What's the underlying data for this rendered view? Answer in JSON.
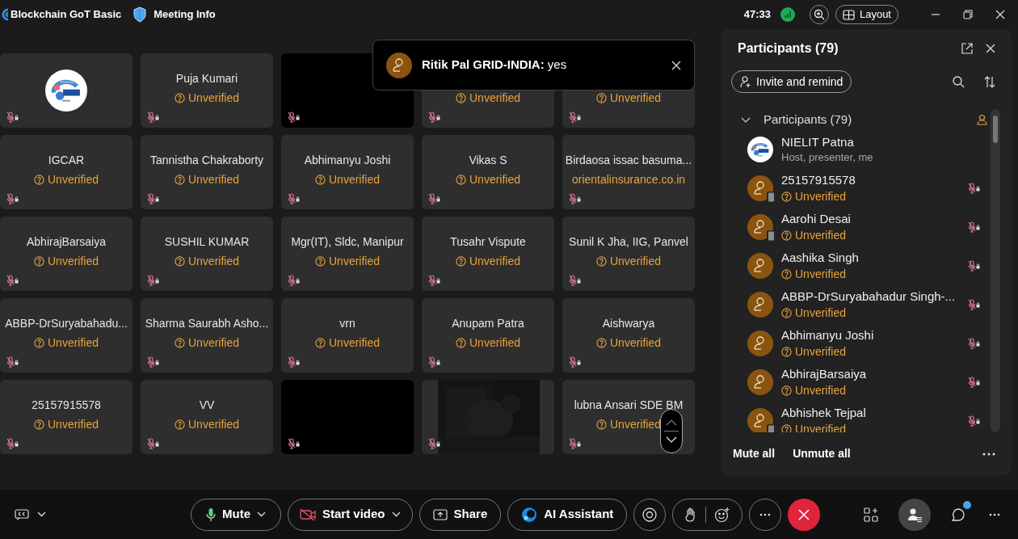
{
  "title_bar": {
    "meeting_name": "Blockchain GoT Basic",
    "meeting_info": "Meeting Info",
    "timer": "47:33",
    "layout_button": "Layout"
  },
  "toast": {
    "sender": "Ritik Pal GRID-INDIA:",
    "message": "yes"
  },
  "tiles": [
    {
      "kind": "logo"
    },
    {
      "kind": "person",
      "name": "Puja Kumari",
      "status": {
        "kind": "unverified",
        "text": "Unverified"
      }
    },
    {
      "kind": "video"
    },
    {
      "kind": "person",
      "status": {
        "kind": "unverified",
        "text": "Unverified"
      }
    },
    {
      "kind": "person",
      "status": {
        "kind": "unverified",
        "text": "Unverified"
      }
    },
    {
      "kind": "person",
      "name": "IGCAR",
      "status": {
        "kind": "unverified",
        "text": "Unverified"
      }
    },
    {
      "kind": "person",
      "name": "Tannistha Chakraborty",
      "status": {
        "kind": "unverified",
        "text": "Unverified"
      }
    },
    {
      "kind": "person",
      "name": "Abhimanyu Joshi",
      "status": {
        "kind": "unverified",
        "text": "Unverified"
      }
    },
    {
      "kind": "person",
      "name": "Vikas S",
      "status": {
        "kind": "unverified",
        "text": "Unverified"
      }
    },
    {
      "kind": "person",
      "name": "Birdaosa issac basuma...",
      "status": {
        "kind": "domain",
        "text": "orientalinsurance.co.in"
      }
    },
    {
      "kind": "person",
      "name": "AbhirajBarsaiya",
      "status": {
        "kind": "unverified",
        "text": "Unverified"
      }
    },
    {
      "kind": "person",
      "name": "SUSHIL KUMAR",
      "status": {
        "kind": "unverified",
        "text": "Unverified"
      }
    },
    {
      "kind": "person",
      "name": "Mgr(IT), Sldc, Manipur",
      "status": {
        "kind": "unverified",
        "text": "Unverified"
      }
    },
    {
      "kind": "person",
      "name": "Tusahr Vispute",
      "status": {
        "kind": "unverified",
        "text": "Unverified"
      }
    },
    {
      "kind": "person",
      "name": "Sunil K Jha, IIG, Panvel",
      "status": {
        "kind": "unverified",
        "text": "Unverified"
      }
    },
    {
      "kind": "person",
      "name": "ABBP-DrSuryabahadu...",
      "status": {
        "kind": "unverified",
        "text": "Unverified"
      }
    },
    {
      "kind": "person",
      "name": "Sharma Saurabh Asho...",
      "status": {
        "kind": "unverified",
        "text": "Unverified"
      }
    },
    {
      "kind": "person",
      "name": "vrn",
      "status": {
        "kind": "unverified",
        "text": "Unverified"
      }
    },
    {
      "kind": "person",
      "name": "Anupam Patra",
      "status": {
        "kind": "unverified",
        "text": "Unverified"
      }
    },
    {
      "kind": "person",
      "name": "Aishwarya",
      "status": {
        "kind": "unverified",
        "text": "Unverified"
      }
    },
    {
      "kind": "person",
      "name": "25157915578",
      "status": {
        "kind": "unverified",
        "text": "Unverified"
      }
    },
    {
      "kind": "person",
      "name": "VV",
      "status": {
        "kind": "unverified",
        "text": "Unverified"
      }
    },
    {
      "kind": "video"
    },
    {
      "kind": "picture"
    },
    {
      "kind": "person",
      "name": "lubna Ansari SDE BM",
      "status": {
        "kind": "unverified",
        "text": "Unverified"
      }
    }
  ],
  "panel": {
    "title": "Participants (79)",
    "invite_button": "Invite and remind",
    "group": {
      "label": "Participants (79)",
      "expanded": true
    },
    "participants": [
      {
        "kind": "logo",
        "name": "NIELIT Patna",
        "subtitle": {
          "kind": "role",
          "text": "Host, presenter, me"
        },
        "mobile": false
      },
      {
        "kind": "person",
        "name": "25157915578",
        "subtitle": {
          "kind": "unverified",
          "text": "Unverified"
        },
        "mobile": true
      },
      {
        "kind": "person",
        "name": "Aarohi Desai",
        "subtitle": {
          "kind": "unverified",
          "text": "Unverified"
        },
        "mobile": true
      },
      {
        "kind": "person",
        "name": "Aashika Singh",
        "subtitle": {
          "kind": "unverified",
          "text": "Unverified"
        },
        "mobile": false
      },
      {
        "kind": "person",
        "name": "ABBP-DrSuryabahadur Singh-...",
        "subtitle": {
          "kind": "unverified",
          "text": "Unverified"
        },
        "mobile": false
      },
      {
        "kind": "person",
        "name": "Abhimanyu Joshi",
        "subtitle": {
          "kind": "unverified",
          "text": "Unverified"
        },
        "mobile": false
      },
      {
        "kind": "person",
        "name": "AbhirajBarsaiya",
        "subtitle": {
          "kind": "unverified",
          "text": "Unverified"
        },
        "mobile": false
      },
      {
        "kind": "person",
        "name": "Abhishek Tejpal",
        "subtitle": {
          "kind": "unverified",
          "text": "Unverified"
        },
        "mobile": true
      }
    ],
    "mute_all": "Mute all",
    "unmute_all": "Unmute all"
  },
  "controls": {
    "mute": "Mute",
    "start_video": "Start video",
    "share": "Share",
    "ai_assistant": "AI Assistant"
  },
  "right_tools": [
    {
      "kind": "apps",
      "selected": false,
      "notification": false
    },
    {
      "kind": "participants",
      "selected": true,
      "notification": false
    },
    {
      "kind": "chat",
      "selected": false,
      "notification": true
    }
  ]
}
